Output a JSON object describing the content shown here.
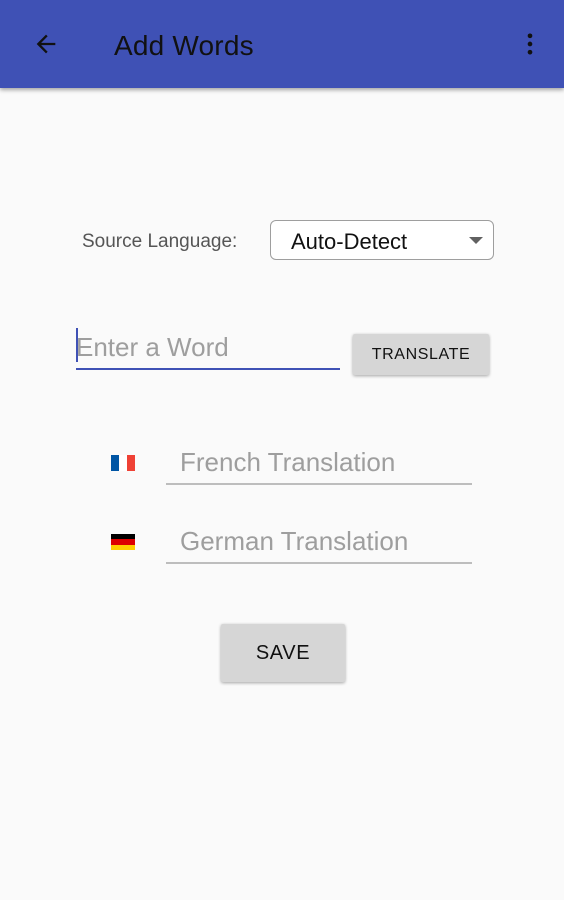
{
  "app_bar": {
    "title": "Add Words",
    "back_icon": "arrow-back-icon",
    "menu_icon": "more-vert-icon",
    "background_color": "#3f51b5"
  },
  "form": {
    "source_language": {
      "label": "Source Language:",
      "selected": "Auto-Detect",
      "caret_icon": "dropdown-caret-icon"
    },
    "word_input": {
      "value": "",
      "placeholder": "Enter a Word",
      "accent_color": "#3f51b5"
    },
    "translate_button": {
      "label": "TRANSLATE"
    },
    "translations": [
      {
        "flag_icon": "france-flag-icon",
        "flag_colors": [
          "#0055a4",
          "#ffffff",
          "#ef4135"
        ],
        "value": "",
        "placeholder": "French Translation"
      },
      {
        "flag_icon": "germany-flag-icon",
        "flag_colors": [
          "#000000",
          "#dd0000",
          "#ffce00"
        ],
        "value": "",
        "placeholder": "German Translation"
      }
    ],
    "save_button": {
      "label": "SAVE"
    }
  }
}
